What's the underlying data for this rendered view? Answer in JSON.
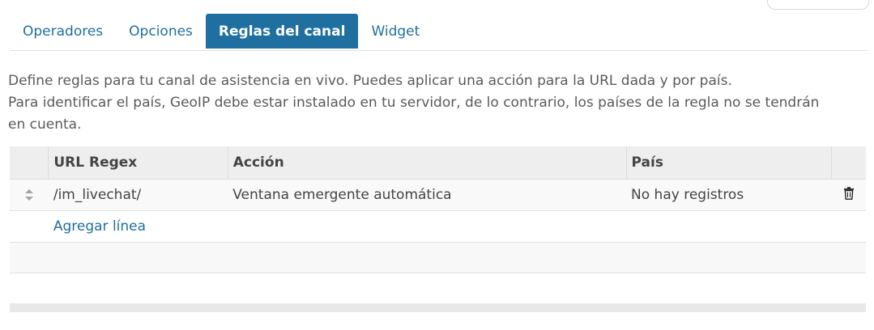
{
  "tabs": [
    {
      "label": "Operadores",
      "active": false
    },
    {
      "label": "Opciones",
      "active": false
    },
    {
      "label": "Reglas del canal",
      "active": true
    },
    {
      "label": "Widget",
      "active": false
    }
  ],
  "description": {
    "line1": "Define reglas para tu canal de asistencia en vivo. Puedes aplicar una acción para la URL dada y por país.",
    "line2": "Para identificar el país, GeoIP debe estar instalado en tu servidor, de lo contrario, los países de la regla no se tendrán",
    "line3": "en cuenta."
  },
  "table": {
    "headers": {
      "url_regex": "URL Regex",
      "accion": "Acción",
      "pais": "País"
    },
    "rows": [
      {
        "url_regex": "/im_livechat/",
        "accion": "Ventana emergente automática",
        "pais": "No hay registros"
      }
    ],
    "add_line": "Agregar línea"
  },
  "colors": {
    "accent": "#1f6fa0",
    "link": "#1f6f9e"
  }
}
